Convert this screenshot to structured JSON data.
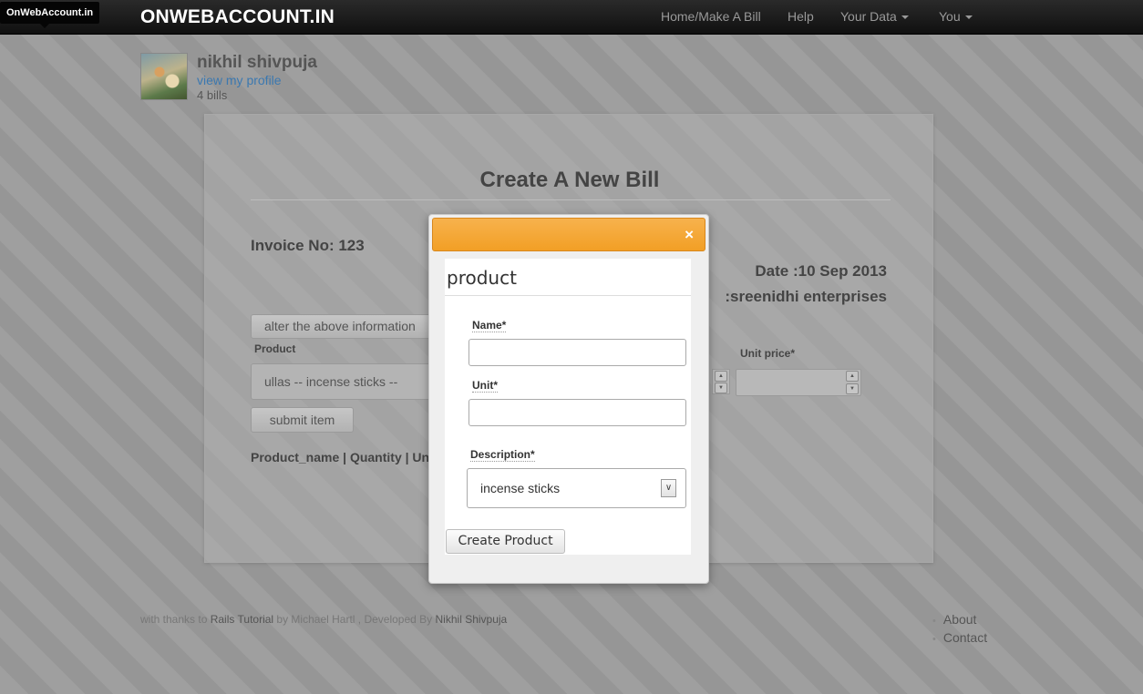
{
  "navbar": {
    "tooltip": "OnWebAccount.in",
    "brand": "ONWEBACCOUNT.IN",
    "links": {
      "home": "Home/Make A Bill",
      "help": "Help",
      "your_data": "Your Data",
      "you": "You"
    }
  },
  "profile": {
    "name": "nikhil shivpuja",
    "link": "view my profile",
    "bills": "4 bills"
  },
  "bill_form": {
    "title": "Create A New Bill",
    "invoice": "Invoice No: 123",
    "date": "Date :10 Sep 2013",
    "company": ":sreenidhi enterprises",
    "alter_button": "alter the above information",
    "product_label": "Product",
    "product_value": "ullas -- incense sticks --",
    "unit_price_label": "Unit price*",
    "submit_button": "submit  item",
    "table_header": "Product_name | Quantity | Un"
  },
  "modal": {
    "close": "×",
    "title": "product",
    "name_label": "Name*",
    "unit_label": "Unit*",
    "description_label": "Description*",
    "description_value": "incense sticks",
    "create_button": "Create Product"
  },
  "footer": {
    "credit_prefix": "with thanks to",
    "credit_link": "Rails Tutorial",
    "credit_middle": "by Michael Hartl , Developed By",
    "credit_author": "Nikhil Shivpuja",
    "links": [
      "About",
      "Contact"
    ]
  }
}
